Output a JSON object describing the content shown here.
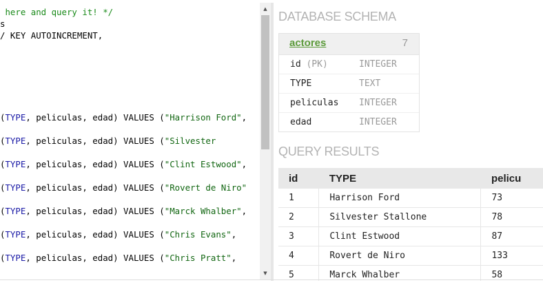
{
  "editor": {
    "lines": [
      {
        "segments": [
          {
            "t": " here and query it! */",
            "c": "comment"
          }
        ]
      },
      {
        "segments": [
          {
            "t": "s",
            "c": ""
          }
        ]
      },
      {
        "segments": [
          {
            "t": "/ KEY AUTOINCREMENT,",
            "c": ""
          }
        ]
      },
      {
        "segments": [
          {
            "t": "(",
            "c": ""
          },
          {
            "t": "TYPE",
            "c": "kw"
          },
          {
            "t": ", peliculas, edad) VALUES (",
            "c": ""
          },
          {
            "t": "\"Harrison Ford\"",
            "c": "str"
          },
          {
            "t": ",",
            "c": ""
          }
        ]
      },
      {
        "segments": [
          {
            "t": "(",
            "c": ""
          },
          {
            "t": "TYPE",
            "c": "kw"
          },
          {
            "t": ", peliculas, edad) VALUES (",
            "c": ""
          },
          {
            "t": "\"Silvester",
            "c": "str"
          }
        ]
      },
      {
        "segments": [
          {
            "t": "(",
            "c": ""
          },
          {
            "t": "TYPE",
            "c": "kw"
          },
          {
            "t": ", peliculas, edad) VALUES (",
            "c": ""
          },
          {
            "t": "\"Clint Estwood\"",
            "c": "str"
          },
          {
            "t": ",",
            "c": ""
          }
        ]
      },
      {
        "segments": [
          {
            "t": "(",
            "c": ""
          },
          {
            "t": "TYPE",
            "c": "kw"
          },
          {
            "t": ", peliculas, edad) VALUES (",
            "c": ""
          },
          {
            "t": "\"Rovert de Niro\"",
            "c": "str"
          }
        ]
      },
      {
        "segments": [
          {
            "t": "(",
            "c": ""
          },
          {
            "t": "TYPE",
            "c": "kw"
          },
          {
            "t": ", peliculas, edad) VALUES (",
            "c": ""
          },
          {
            "t": "\"Marck Whalber\"",
            "c": "str"
          },
          {
            "t": ",",
            "c": ""
          }
        ]
      },
      {
        "segments": [
          {
            "t": "(",
            "c": ""
          },
          {
            "t": "TYPE",
            "c": "kw"
          },
          {
            "t": ", peliculas, edad) VALUES (",
            "c": ""
          },
          {
            "t": "\"Chris Evans\"",
            "c": "str"
          },
          {
            "t": ",",
            "c": ""
          }
        ]
      },
      {
        "segments": [
          {
            "t": "(",
            "c": ""
          },
          {
            "t": "TYPE",
            "c": "kw"
          },
          {
            "t": ", peliculas, edad) VALUES (",
            "c": ""
          },
          {
            "t": "\"Chris Pratt\"",
            "c": "str"
          },
          {
            "t": ",",
            "c": ""
          }
        ]
      }
    ]
  },
  "scrollbar": {
    "up_icon": "▲",
    "down_icon": "▼"
  },
  "schema": {
    "title": "DATABASE SCHEMA",
    "table_name": "actores",
    "count": "7",
    "columns": [
      {
        "name": "id",
        "pk": "(PK)",
        "type": "INTEGER"
      },
      {
        "name": "TYPE",
        "pk": "",
        "type": "TEXT"
      },
      {
        "name": "peliculas",
        "pk": "",
        "type": "INTEGER"
      },
      {
        "name": "edad",
        "pk": "",
        "type": "INTEGER"
      }
    ]
  },
  "results": {
    "title": "QUERY RESULTS",
    "headers": [
      "id",
      "TYPE",
      "pelicu"
    ],
    "rows": [
      [
        "1",
        "Harrison Ford",
        "73"
      ],
      [
        "2",
        "Silvester Stallone",
        "78"
      ],
      [
        "3",
        "Clint Estwood",
        "87"
      ],
      [
        "4",
        "Rovert de Niro",
        "133"
      ],
      [
        "5",
        "Marck Whalber",
        "58"
      ]
    ]
  }
}
